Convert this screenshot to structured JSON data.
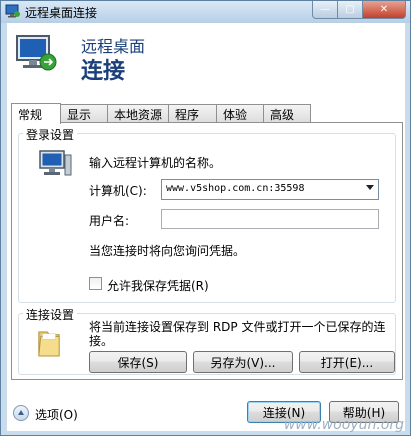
{
  "window": {
    "title": "远程桌面连接",
    "minimize_glyph": "—",
    "maximize_glyph": "□",
    "close_glyph": "✕"
  },
  "header": {
    "subtitle": "远程桌面",
    "title": "连接"
  },
  "tabs": [
    {
      "label": "常规",
      "active": true
    },
    {
      "label": "显示",
      "active": false
    },
    {
      "label": "本地资源",
      "active": false
    },
    {
      "label": "程序",
      "active": false
    },
    {
      "label": "体验",
      "active": false
    },
    {
      "label": "高级",
      "active": false
    }
  ],
  "login": {
    "group_title": "登录设置",
    "prompt": "输入远程计算机的名称。",
    "computer_label": "计算机(C):",
    "computer_value": "www.v5shop.com.cn:35598",
    "username_label": "用户名:",
    "username_value": "",
    "note": "当您连接时将向您询问凭据。",
    "save_credentials_label": "允许我保存凭据(R)",
    "save_credentials_checked": false
  },
  "connection": {
    "group_title": "连接设置",
    "description": "将当前连接设置保存到 RDP 文件或打开一个已保存的连接。",
    "save_button": "保存(S)",
    "save_as_button": "另存为(V)...",
    "open_button": "打开(E)..."
  },
  "footer": {
    "options_label": "选项(O)",
    "connect_button": "连接(N)",
    "help_button": "帮助(H)"
  },
  "watermark": "www.wooyun.org"
}
